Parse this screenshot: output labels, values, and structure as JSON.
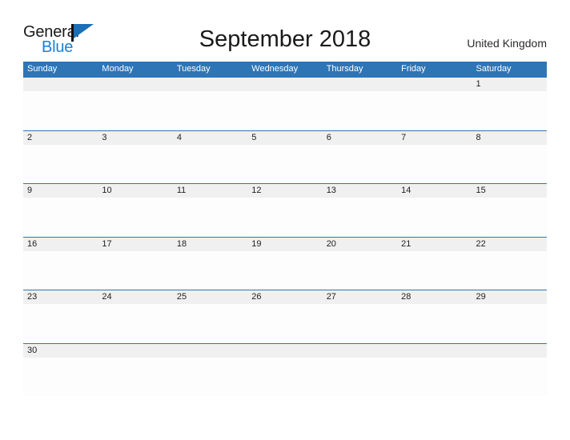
{
  "header": {
    "logo": {
      "primary_text": "General",
      "secondary_text": "Blue",
      "flag_icon": "flag-triangle-icon",
      "primary_color": "#1a1a1a",
      "secondary_color": "#1b7fd4"
    },
    "title": "September 2018",
    "country": "United Kingdom"
  },
  "calendar": {
    "accent_color": "#2e75b6",
    "band_color": "#f0f0f0",
    "weekdays": [
      "Sunday",
      "Monday",
      "Tuesday",
      "Wednesday",
      "Thursday",
      "Friday",
      "Saturday"
    ],
    "weeks": [
      [
        "",
        "",
        "",
        "",
        "",
        "",
        "1"
      ],
      [
        "2",
        "3",
        "4",
        "5",
        "6",
        "7",
        "8"
      ],
      [
        "9",
        "10",
        "11",
        "12",
        "13",
        "14",
        "15"
      ],
      [
        "16",
        "17",
        "18",
        "19",
        "20",
        "21",
        "22"
      ],
      [
        "23",
        "24",
        "25",
        "26",
        "27",
        "28",
        "29"
      ],
      [
        "30",
        "",
        "",
        "",
        "",
        "",
        ""
      ]
    ]
  }
}
